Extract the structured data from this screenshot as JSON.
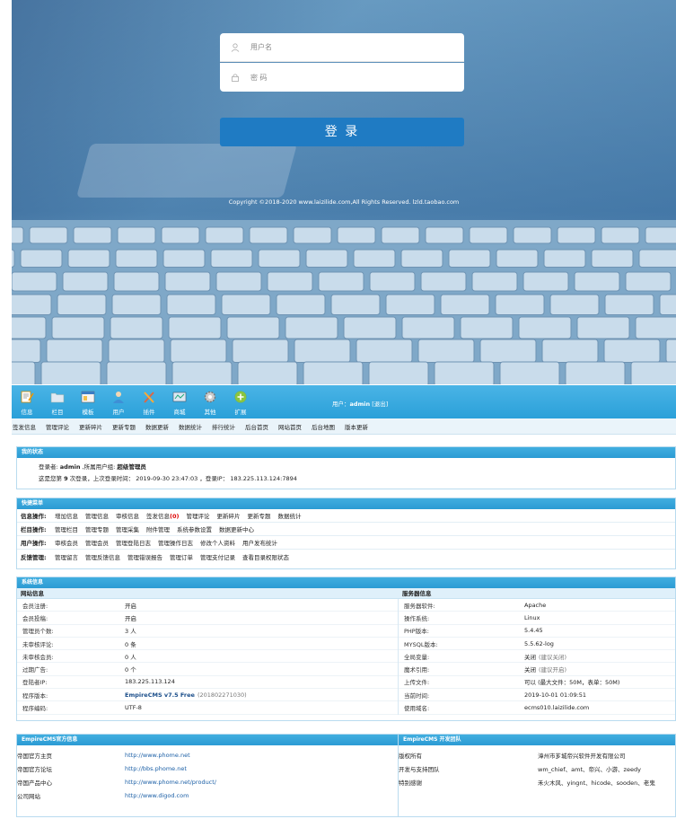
{
  "login": {
    "username_placeholder": "用户名",
    "password_placeholder": "密 码",
    "login_button": "登 录",
    "copyright": "Copyright ©2018-2020 www.laizilide.com,All Rights Reserved. lzld.taobao.com"
  },
  "toolbar": {
    "items": [
      {
        "label": "信息",
        "icon": "document-pencil-icon"
      },
      {
        "label": "栏目",
        "icon": "folder-icon"
      },
      {
        "label": "模板",
        "icon": "window-icon"
      },
      {
        "label": "用户",
        "icon": "user-icon"
      },
      {
        "label": "插件",
        "icon": "tools-icon"
      },
      {
        "label": "商城",
        "icon": "shop-icon"
      },
      {
        "label": "其他",
        "icon": "gear-icon"
      },
      {
        "label": "扩展",
        "icon": "plus-circle-icon"
      }
    ],
    "user_prefix": "用户：",
    "user_name": "admin",
    "logout": "[退出]"
  },
  "submenu": [
    "签发信息",
    "管理评论",
    "更新碎片",
    "更新专题",
    "数据更新",
    "数据统计",
    "排行统计",
    "后台首页",
    "网站首页",
    "后台地图",
    "版本更新"
  ],
  "status": {
    "title": "我的状态",
    "line1_a": "登录者:",
    "line1_user": "admin",
    "line1_b": ",所属用户组:",
    "line1_group": "超级管理员",
    "line2_a": "这是您第",
    "line2_count": "9",
    "line2_b": "次登录，上次登录时间：",
    "line2_time": "2019-09-30 23:47:03",
    "line2_c": "，登录IP：",
    "line2_ip": "183.225.113.124:7894"
  },
  "quick": {
    "title": "快捷菜单",
    "rows": [
      {
        "label": "信息操作:",
        "items": [
          "增加信息",
          "管理信息",
          "审核信息",
          "签发信息",
          "管理评论",
          "更新碎片",
          "更新专题",
          "数据统计"
        ],
        "badge": "(0)"
      },
      {
        "label": "栏目操作:",
        "items": [
          "管理栏目",
          "管理专题",
          "管理采集",
          "附件管理",
          "系统参数设置",
          "数据更新中心"
        ]
      },
      {
        "label": "用户操作:",
        "items": [
          "审核会员",
          "管理会员",
          "管理登陆日志",
          "管理操作日志",
          "修改个人资料",
          "用户发布统计"
        ]
      },
      {
        "label": "反馈管理:",
        "items": [
          "管理留言",
          "管理反馈信息",
          "管理错误报告",
          "管理订单",
          "管理支付记录",
          "查看目录权限状态"
        ]
      }
    ]
  },
  "system": {
    "title": "系统信息",
    "site_title": "网站信息",
    "server_title": "服务器信息",
    "site": [
      {
        "k": "会员注册:",
        "v": "开启"
      },
      {
        "k": "会员投稿:",
        "v": "开启"
      },
      {
        "k": "管理员个数:",
        "v": "3 人"
      },
      {
        "k": "未审核评论:",
        "v": "0 条"
      },
      {
        "k": "未审核会员:",
        "v": "0 人"
      },
      {
        "k": "过期广告:",
        "v": "0 个"
      },
      {
        "k": "登陆者IP:",
        "v": "183.225.113.124"
      },
      {
        "k": "程序版本:",
        "v": "EmpireCMS v7.5 Free",
        "extra": "(201802271030)"
      },
      {
        "k": "程序编码:",
        "v": "UTF-8"
      }
    ],
    "server": [
      {
        "k": "服务器软件:",
        "v": "Apache"
      },
      {
        "k": "操作系统:",
        "v": "Linux"
      },
      {
        "k": "PHP版本:",
        "v": "5.4.45"
      },
      {
        "k": "MYSQL版本:",
        "v": "5.5.62-log"
      },
      {
        "k": "全局变量:",
        "v": "关闭",
        "extra": "(建议关闭)"
      },
      {
        "k": "魔术引用:",
        "v": "关闭",
        "extra": "(建议开启)"
      },
      {
        "k": "上传文件:",
        "v": "可以 (最大文件：50M，表单：50M)"
      },
      {
        "k": "当前时间:",
        "v": "2019-10-01 01:09:51"
      },
      {
        "k": "使用域名:",
        "v": "ecms010.laizilide.com"
      }
    ]
  },
  "official": {
    "title": "EmpireCMS官方信息",
    "rows": [
      {
        "k": "帝国官方主页",
        "v": "http://www.phome.net"
      },
      {
        "k": "帝国官方论坛",
        "v": "http://bbs.phome.net"
      },
      {
        "k": "帝国产品中心",
        "v": "http://www.phome.net/product/"
      },
      {
        "k": "公司网站",
        "v": "http://www.digod.com"
      }
    ]
  },
  "team": {
    "title": "EmpireCMS 开发团队",
    "rows": [
      {
        "k": "版权所有",
        "v": "漳州市芗城帝兴软件开发有限公司"
      },
      {
        "k": "开发与支持团队",
        "v": "wm_chief、amt、帝兴、小游、zeedy"
      },
      {
        "k": "特别感谢",
        "v": "禾火木风、yingnt、hicode、sooden、老鬼"
      }
    ]
  }
}
